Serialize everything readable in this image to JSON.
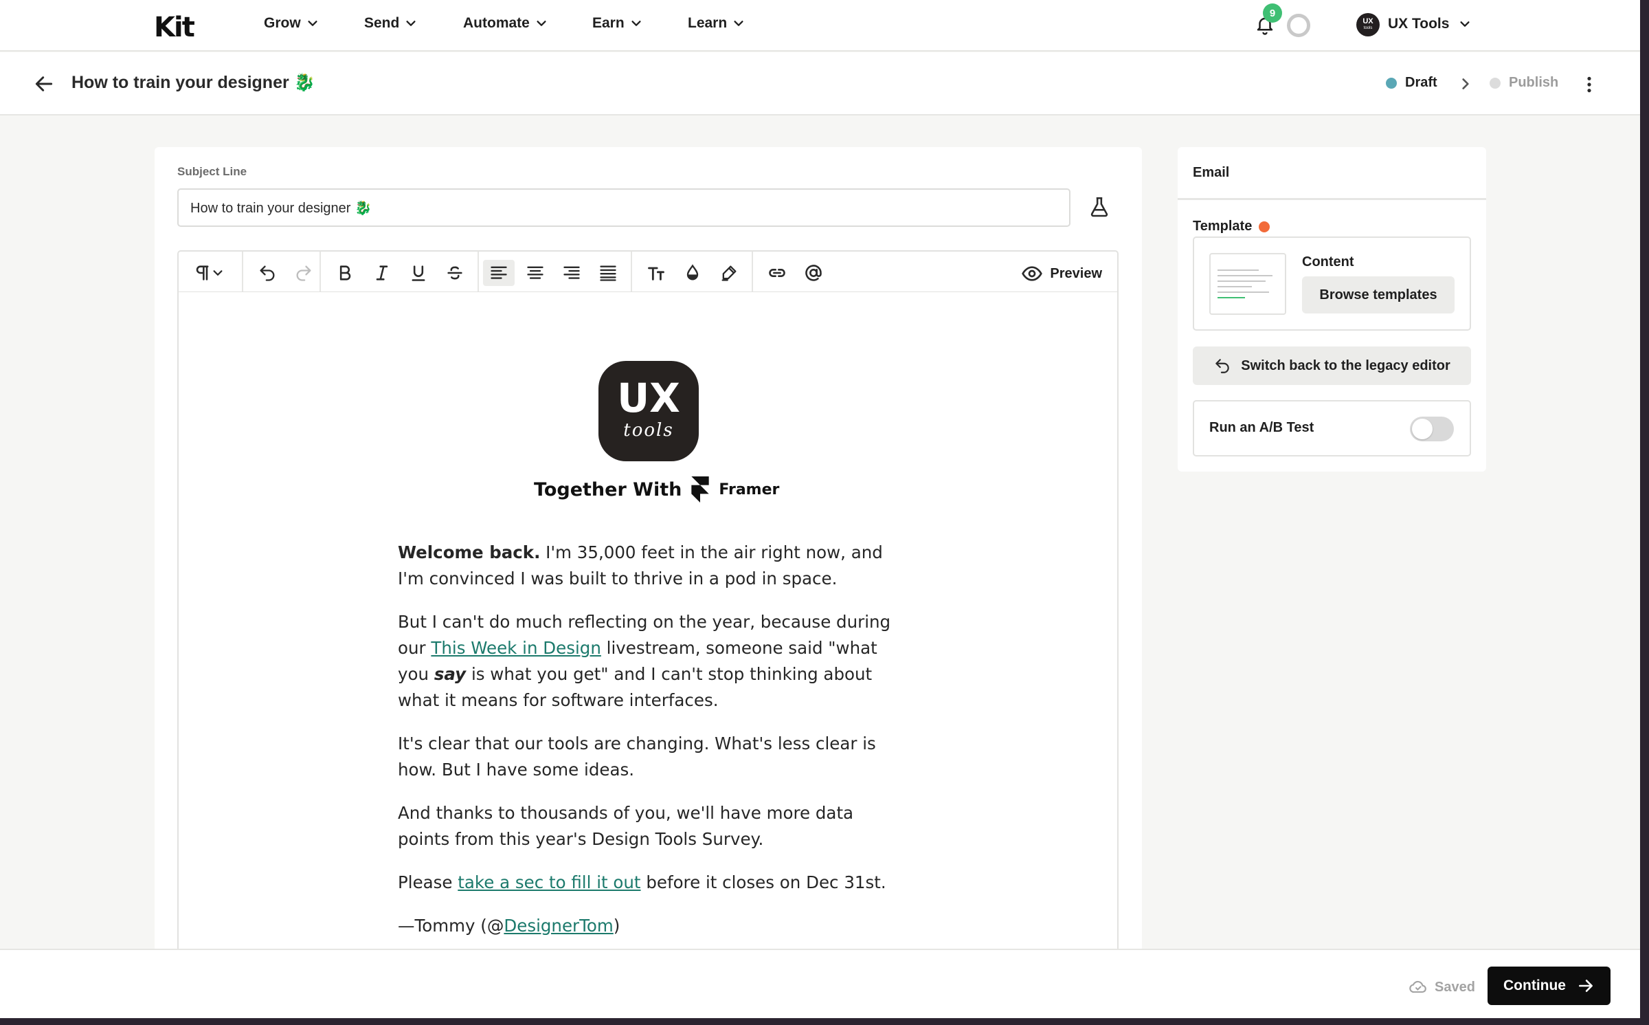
{
  "app": {
    "logo": "Kit"
  },
  "nav": {
    "items": [
      {
        "label": "Grow"
      },
      {
        "label": "Send"
      },
      {
        "label": "Automate"
      },
      {
        "label": "Earn"
      },
      {
        "label": "Learn"
      }
    ],
    "notification_count": "9",
    "account": {
      "avatar_text_top": "UX",
      "avatar_text_bottom": "tools",
      "name": "UX Tools"
    }
  },
  "header": {
    "title": "How to train your designer 🐉",
    "steps": [
      {
        "label": "Draft",
        "color": "#5aa7b5",
        "active": true
      },
      {
        "label": "Publish",
        "color": "#d9d9d9",
        "active": false
      }
    ]
  },
  "editor": {
    "subject_label": "Subject Line",
    "subject_value": "How to train your designer 🐉",
    "toolbar": {
      "preview_label": "Preview",
      "tools": [
        "paragraph-style",
        "undo",
        "redo",
        "bold",
        "italic",
        "underline",
        "strikethrough",
        "align-left",
        "align-center",
        "align-right",
        "align-justify",
        "text-size",
        "text-color",
        "highlight",
        "link",
        "mention"
      ],
      "active_tool": "align-left"
    },
    "content": {
      "logo_big": "UX",
      "logo_small": "tools",
      "together_with": "Together With",
      "sponsor": "Framer",
      "p1_bold": "Welcome back.",
      "p1_rest": " I'm 35,000 feet in the air right now, and I'm convinced I was built to thrive in a pod in space.",
      "p2_a": "But I can't do much reflecting on the year, because during our ",
      "p2_link": "This Week in Design",
      "p2_b": " livestream, someone said \"what you ",
      "p2_em": "say",
      "p2_c": " is what you get\" and I can't stop thinking about what it means for software interfaces.",
      "p3": "It's clear that our tools are changing. What's less clear is how. But I have some ideas.",
      "p4": "And thanks to thousands of you, we'll have more data points from this year's Design Tools Survey.",
      "p5_a": "Please ",
      "p5_link": "take a sec to fill it out",
      "p5_b": " before it closes on Dec 31st.",
      "p6_a": "—Tommy (@",
      "p6_link": "DesignerTom",
      "p6_b": ")"
    }
  },
  "sidebar": {
    "tab": "Email",
    "template_label": "Template",
    "template_dot_color": "#f26b3a",
    "content_label": "Content",
    "browse_label": "Browse templates",
    "legacy_label": "Switch back to the legacy editor",
    "ab_label": "Run an A/B Test",
    "ab_enabled": false
  },
  "footer": {
    "saved_label": "Saved",
    "continue_label": "Continue"
  }
}
